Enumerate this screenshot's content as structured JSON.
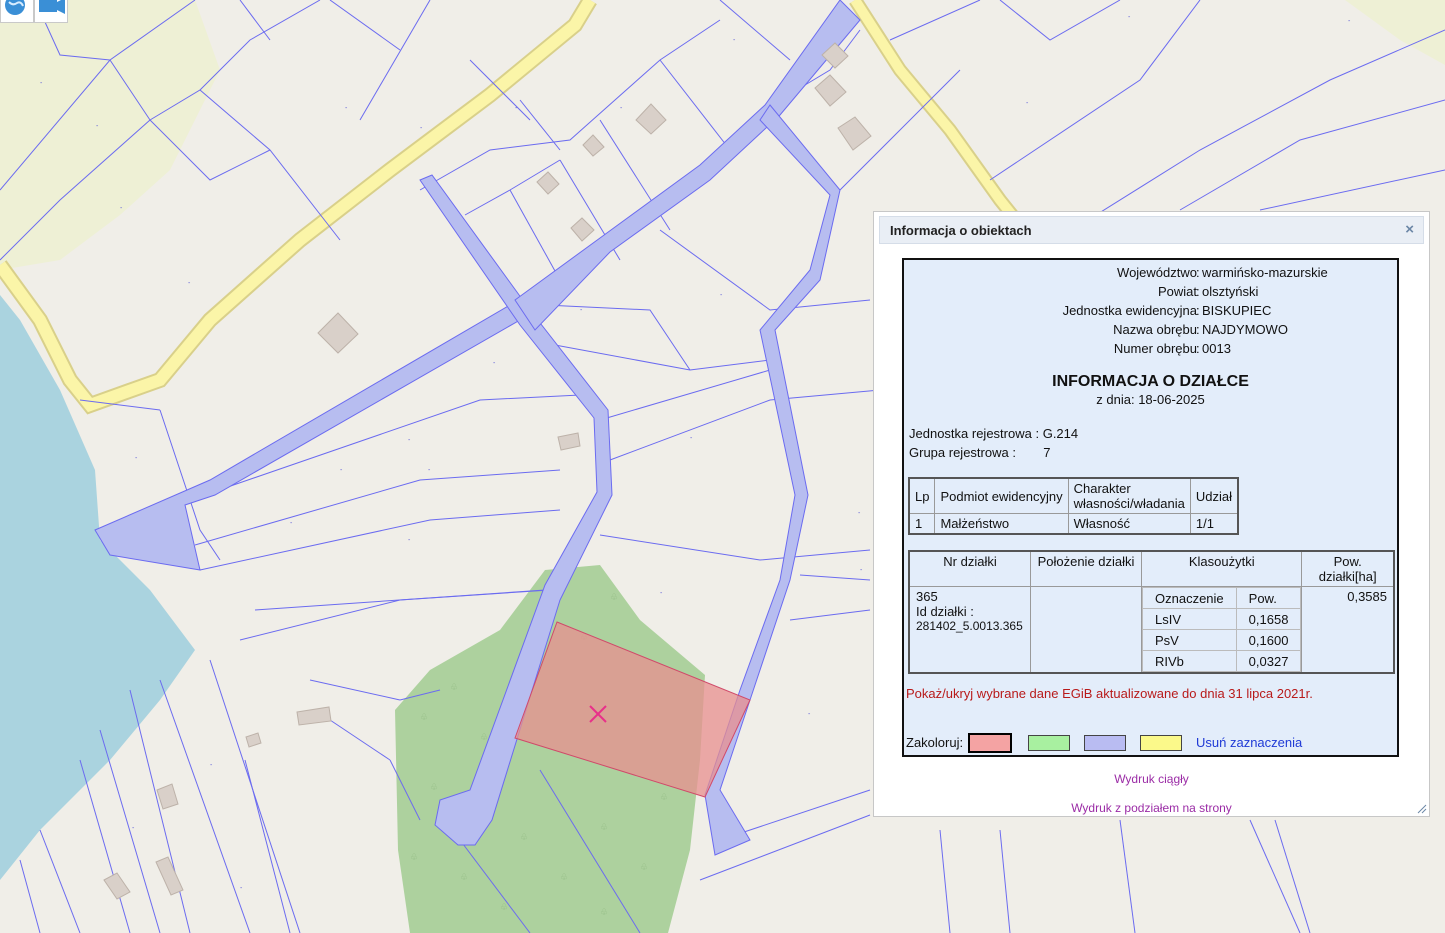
{
  "map": {
    "colors": {
      "background": "#f0eee8",
      "parcel_line": "#6b6bf0",
      "road_fill": "#b7bdf0",
      "main_road": "#fbf5a8",
      "main_road_edge": "#d9d08a",
      "water": "#aad3df",
      "forest": "#add19e",
      "farmland": "#eef0d5",
      "building": "#d9d0c9",
      "selected_parcel": "#e88f8f",
      "marker": "#e8308a"
    },
    "tools": {
      "globe_icon": "globe-icon",
      "video_icon": "video-camera-icon"
    },
    "selected_marker_icon": "x-marker-icon"
  },
  "popup": {
    "title": "Informacja o obiektach",
    "close_icon": "×",
    "admin": {
      "voivodeship_label": "Województwo",
      "voivodeship_value": "warmińsko-mazurskie",
      "county_label": "Powiat",
      "county_value": "olsztyński",
      "unit_label": "Jednostka ewidencyjna",
      "unit_value": "BISKUPIEC",
      "precinct_name_label": "Nazwa obrębu",
      "precinct_name_value": "NAJDYMOWO",
      "precinct_number_label": "Numer obrębu",
      "precinct_number_value": "0013",
      "colon": ":"
    },
    "document_title": "INFORMACJA O DZIAŁCE",
    "document_date": "z dnia: 18-06-2025",
    "registry": {
      "unit_label": "Jednostka rejestrowa :",
      "unit_value": "G.214",
      "group_label": "Grupa rejestrowa :",
      "group_value": "7"
    },
    "owners_table": {
      "headers": [
        "Lp",
        "Podmiot ewidencyjny",
        "Charakter\nwłasności/władania",
        "Udział"
      ],
      "header_line1": "Charakter",
      "header_line2": "własności/władania",
      "rows": [
        [
          "1",
          "Małżeństwo",
          "Własność",
          "1/1"
        ]
      ]
    },
    "parcel_table": {
      "headers": [
        "Nr działki",
        "Położenie działki",
        "Klasoużytki",
        "Pow. działki[ha]"
      ],
      "parcel_number": "365",
      "id_label": "Id działki :",
      "id_value": "281402_5.0013.365",
      "location": "",
      "class_headers": [
        "Oznaczenie",
        "Pow."
      ],
      "classes": [
        [
          "LsIV",
          "0,1658"
        ],
        [
          "PsV",
          "0,1600"
        ],
        [
          "RIVb",
          "0,0327"
        ]
      ],
      "area": "0,3585"
    },
    "egib_link": "Pokaż/ukryj wybrane dane EGiB aktualizowane do dnia 31 lipca 2021r.",
    "colorize": {
      "label": "Zakoloruj:",
      "swatches": [
        "#f4a3a3",
        "#a8f0a0",
        "#b9bcf2",
        "#fbf98a"
      ],
      "selected_index": 0,
      "clear_label": "Usuń zaznaczenia"
    },
    "print_continuous": "Wydruk ciągły",
    "print_paged": "Wydruk z podziałem na strony"
  }
}
